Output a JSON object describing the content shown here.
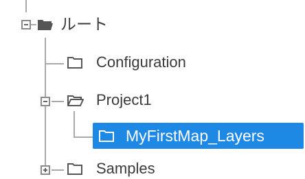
{
  "tree": {
    "root": {
      "label": "ルート",
      "expanded": true,
      "icon": "folder-filled-icon"
    },
    "children": [
      {
        "label": "Configuration",
        "icon": "folder-outline-icon",
        "expanded": null,
        "selected": false
      },
      {
        "label": "Project1",
        "icon": "folder-open-outline-icon",
        "expanded": true,
        "selected": false,
        "children": [
          {
            "label": "MyFirstMap_Layers",
            "icon": "folder-outline-icon",
            "selected": true
          }
        ]
      },
      {
        "label": "Samples",
        "icon": "folder-outline-icon",
        "expanded": false,
        "selected": false
      }
    ]
  },
  "colors": {
    "selection": "#1e88e5",
    "text": "#3a3a3a",
    "lines": "#a9a9a9"
  }
}
